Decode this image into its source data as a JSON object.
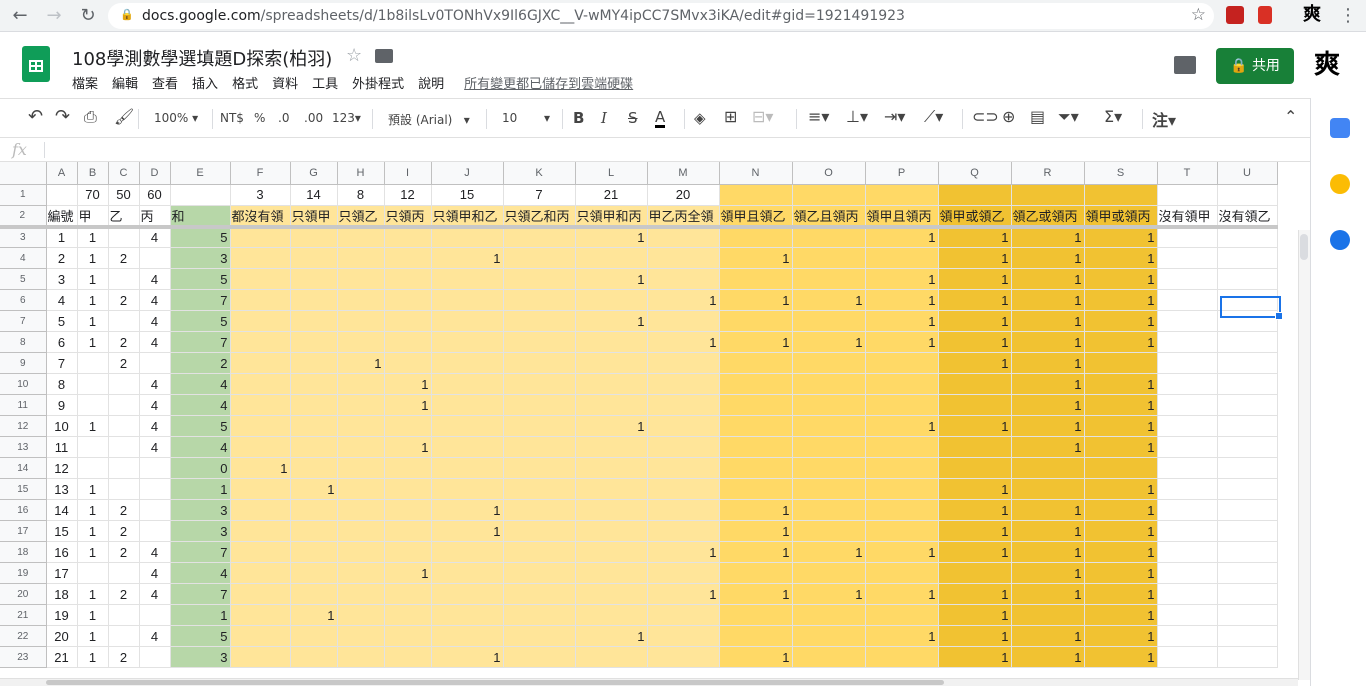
{
  "browser": {
    "url_host": "docs.google.com",
    "url_path": "/spreadsheets/d/1b8ilsLv0TONhVx9Il6GJXC__V-wMY4ipCC7SMvx3iKA/edit#gid=1921491923"
  },
  "header": {
    "title": "108學測數學選填題D探索(柏羽)",
    "menu": [
      "檔案",
      "編輯",
      "查看",
      "插入",
      "格式",
      "資料",
      "工具",
      "外掛程式",
      "說明"
    ],
    "saved_status": "所有變更都已儲存到雲端硬碟",
    "share_label": "共用",
    "avatar_text": "爽"
  },
  "toolbar": {
    "zoom": "100%",
    "currency": "NT$",
    "percent": "%",
    "dec_less": ".0",
    "dec_more": ".00",
    "format": "123",
    "font": "預設 (Arial)",
    "font_size": "10",
    "bold": "B",
    "italic": "I",
    "strike": "S",
    "textcolor": "A",
    "more": "注"
  },
  "formula": {
    "fx": "fx"
  },
  "columns": [
    "A",
    "B",
    "C",
    "D",
    "E",
    "F",
    "G",
    "H",
    "I",
    "J",
    "K",
    "L",
    "M",
    "N",
    "O",
    "P",
    "Q",
    "R",
    "S",
    "T",
    "U"
  ],
  "row1": [
    "",
    "70",
    "50",
    "60",
    "",
    "3",
    "14",
    "8",
    "12",
    "15",
    "7",
    "21",
    "20",
    "",
    "",
    "",
    "",
    "",
    "",
    "",
    ""
  ],
  "row2": [
    "編號",
    "甲",
    "乙",
    "丙",
    "和",
    "都沒有領",
    "只領甲",
    "只領乙",
    "只領丙",
    "只領甲和乙",
    "只領乙和丙",
    "只領甲和丙",
    "甲乙丙全領",
    "領甲且領乙",
    "領乙且領丙",
    "領甲且領丙",
    "領甲或領乙",
    "領乙或領丙",
    "領甲或領丙",
    "沒有領甲",
    "沒有領乙"
  ],
  "rows": [
    {
      "n": "3",
      "c": [
        "1",
        "1",
        "",
        "4",
        "5",
        "",
        "",
        "",
        "",
        "",
        "",
        "1",
        "",
        "",
        "",
        "1",
        "1",
        "1",
        "1",
        "",
        ""
      ]
    },
    {
      "n": "4",
      "c": [
        "2",
        "1",
        "2",
        "",
        "3",
        "",
        "",
        "",
        "",
        "1",
        "",
        "",
        "",
        "1",
        "",
        "",
        "1",
        "1",
        "1",
        "",
        ""
      ]
    },
    {
      "n": "5",
      "c": [
        "3",
        "1",
        "",
        "4",
        "5",
        "",
        "",
        "",
        "",
        "",
        "",
        "1",
        "",
        "",
        "",
        "1",
        "1",
        "1",
        "1",
        "",
        ""
      ]
    },
    {
      "n": "6",
      "c": [
        "4",
        "1",
        "2",
        "4",
        "7",
        "",
        "",
        "",
        "",
        "",
        "",
        "",
        "1",
        "1",
        "1",
        "1",
        "1",
        "1",
        "1",
        "",
        ""
      ]
    },
    {
      "n": "7",
      "c": [
        "5",
        "1",
        "",
        "4",
        "5",
        "",
        "",
        "",
        "",
        "",
        "",
        "1",
        "",
        "",
        "",
        "1",
        "1",
        "1",
        "1",
        "",
        ""
      ]
    },
    {
      "n": "8",
      "c": [
        "6",
        "1",
        "2",
        "4",
        "7",
        "",
        "",
        "",
        "",
        "",
        "",
        "",
        "1",
        "1",
        "1",
        "1",
        "1",
        "1",
        "1",
        "",
        ""
      ]
    },
    {
      "n": "9",
      "c": [
        "7",
        "",
        "2",
        "",
        "2",
        "",
        "",
        "1",
        "",
        "",
        "",
        "",
        "",
        "",
        "",
        "",
        "1",
        "1",
        "",
        "",
        ""
      ]
    },
    {
      "n": "10",
      "c": [
        "8",
        "",
        "",
        "4",
        "4",
        "",
        "",
        "",
        "1",
        "",
        "",
        "",
        "",
        "",
        "",
        "",
        "",
        "1",
        "1",
        "",
        ""
      ]
    },
    {
      "n": "11",
      "c": [
        "9",
        "",
        "",
        "4",
        "4",
        "",
        "",
        "",
        "1",
        "",
        "",
        "",
        "",
        "",
        "",
        "",
        "",
        "1",
        "1",
        "",
        ""
      ]
    },
    {
      "n": "12",
      "c": [
        "10",
        "1",
        "",
        "4",
        "5",
        "",
        "",
        "",
        "",
        "",
        "",
        "1",
        "",
        "",
        "",
        "1",
        "1",
        "1",
        "1",
        "",
        ""
      ]
    },
    {
      "n": "13",
      "c": [
        "11",
        "",
        "",
        "4",
        "4",
        "",
        "",
        "",
        "1",
        "",
        "",
        "",
        "",
        "",
        "",
        "",
        "",
        "1",
        "1",
        "",
        ""
      ]
    },
    {
      "n": "14",
      "c": [
        "12",
        "",
        "",
        "",
        "0",
        "1",
        "",
        "",
        "",
        "",
        "",
        "",
        "",
        "",
        "",
        "",
        "",
        "",
        "",
        "",
        ""
      ]
    },
    {
      "n": "15",
      "c": [
        "13",
        "1",
        "",
        "",
        "1",
        "",
        "1",
        "",
        "",
        "",
        "",
        "",
        "",
        "",
        "",
        "",
        "1",
        "",
        "1",
        "",
        ""
      ]
    },
    {
      "n": "16",
      "c": [
        "14",
        "1",
        "2",
        "",
        "3",
        "",
        "",
        "",
        "",
        "1",
        "",
        "",
        "",
        "1",
        "",
        "",
        "1",
        "1",
        "1",
        "",
        ""
      ]
    },
    {
      "n": "17",
      "c": [
        "15",
        "1",
        "2",
        "",
        "3",
        "",
        "",
        "",
        "",
        "1",
        "",
        "",
        "",
        "1",
        "",
        "",
        "1",
        "1",
        "1",
        "",
        ""
      ]
    },
    {
      "n": "18",
      "c": [
        "16",
        "1",
        "2",
        "4",
        "7",
        "",
        "",
        "",
        "",
        "",
        "",
        "",
        "1",
        "1",
        "1",
        "1",
        "1",
        "1",
        "1",
        "",
        ""
      ]
    },
    {
      "n": "19",
      "c": [
        "17",
        "",
        "",
        "4",
        "4",
        "",
        "",
        "",
        "1",
        "",
        "",
        "",
        "",
        "",
        "",
        "",
        "",
        "1",
        "1",
        "",
        ""
      ]
    },
    {
      "n": "20",
      "c": [
        "18",
        "1",
        "2",
        "4",
        "7",
        "",
        "",
        "",
        "",
        "",
        "",
        "",
        "1",
        "1",
        "1",
        "1",
        "1",
        "1",
        "1",
        "",
        ""
      ]
    },
    {
      "n": "21",
      "c": [
        "19",
        "1",
        "",
        "",
        "1",
        "",
        "1",
        "",
        "",
        "",
        "",
        "",
        "",
        "",
        "",
        "",
        "1",
        "",
        "1",
        "",
        ""
      ]
    },
    {
      "n": "22",
      "c": [
        "20",
        "1",
        "",
        "4",
        "5",
        "",
        "",
        "",
        "",
        "",
        "",
        "1",
        "",
        "",
        "",
        "1",
        "1",
        "1",
        "1",
        "",
        ""
      ]
    },
    {
      "n": "23",
      "c": [
        "21",
        "1",
        "2",
        "",
        "3",
        "",
        "",
        "",
        "",
        "1",
        "",
        "",
        "",
        "1",
        "",
        "",
        "1",
        "1",
        "1",
        "",
        ""
      ]
    }
  ],
  "colors": {
    "green": "#b7d7a8",
    "light_yellow": "#ffe599",
    "mid_yellow": "#ffd966",
    "dark_yellow": "#f1c232"
  }
}
